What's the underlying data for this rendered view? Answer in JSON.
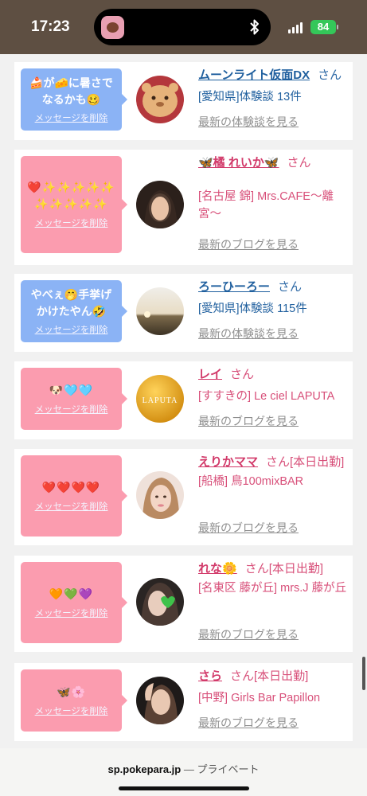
{
  "status_bar": {
    "time": "17:23",
    "battery": "84"
  },
  "messages": [
    {
      "bubble_type": "blue",
      "bubble_text": "🍰が🧀に暑さでなるかも🥴",
      "delete_label": "メッセージを削除",
      "name": "ムーンライト仮面DX",
      "suffix": "さん",
      "detail": "[愛知県]体験談 13件",
      "latest": "最新の体験談を見る",
      "avatar": "avatar-1"
    },
    {
      "bubble_type": "pink",
      "bubble_text": "❤️✨✨✨✨✨✨✨✨✨✨",
      "delete_label": "メッセージを削除",
      "name": "🦋橘 れいか🦋",
      "suffix": "さん",
      "detail": "[名古屋 錦] Mrs.CAFE〜離宮〜",
      "latest": "最新のブログを見る",
      "avatar": "avatar-2"
    },
    {
      "bubble_type": "blue",
      "bubble_text": "やべぇ🤭手挙げかけたやん🤣",
      "delete_label": "メッセージを削除",
      "name": "ろーひーろー",
      "suffix": "さん",
      "detail": "[愛知県]体験談 115件",
      "latest": "最新の体験談を見る",
      "avatar": "avatar-3"
    },
    {
      "bubble_type": "pink",
      "bubble_text": "🐶🩵🩵",
      "delete_label": "メッセージを削除",
      "name": "レイ",
      "suffix": "さん",
      "detail": "[すすきの] Le ciel LAPUTA",
      "latest": "最新のブログを見る",
      "avatar": "avatar-4",
      "avatar_text": "LAPUTA"
    },
    {
      "bubble_type": "pink",
      "bubble_text": "❤️❤️❤️❤️",
      "delete_label": "メッセージを削除",
      "name": "えりかママ",
      "suffix": "さん[本日出勤]",
      "detail": "[船橋] 鳥100mixBAR",
      "latest": "最新のブログを見る",
      "avatar": "avatar-5"
    },
    {
      "bubble_type": "pink",
      "bubble_text": "🧡💚💜",
      "delete_label": "メッセージを削除",
      "name": "れな🌼",
      "suffix": "さん[本日出勤]",
      "detail": "[名東区 藤が丘] mrs.J 藤が丘",
      "latest": "最新のブログを見る",
      "avatar": "avatar-6"
    },
    {
      "bubble_type": "pink",
      "bubble_text": "🦋🌸",
      "delete_label": "メッセージを削除",
      "name": "さら",
      "suffix": "さん[本日出勤]",
      "detail": "[中野] Girls Bar Papillon",
      "latest": "最新のブログを見る",
      "avatar": "avatar-7"
    }
  ],
  "bottom_bar": {
    "site": "sp.pokepara.jp",
    "separator": "—",
    "mode": "プライベート"
  },
  "colors": {
    "blue_bubble": "#8bb3f5",
    "pink_bubble": "#fb9caf",
    "blue_text": "#1f5f9e",
    "pink_text": "#d23a6a"
  }
}
